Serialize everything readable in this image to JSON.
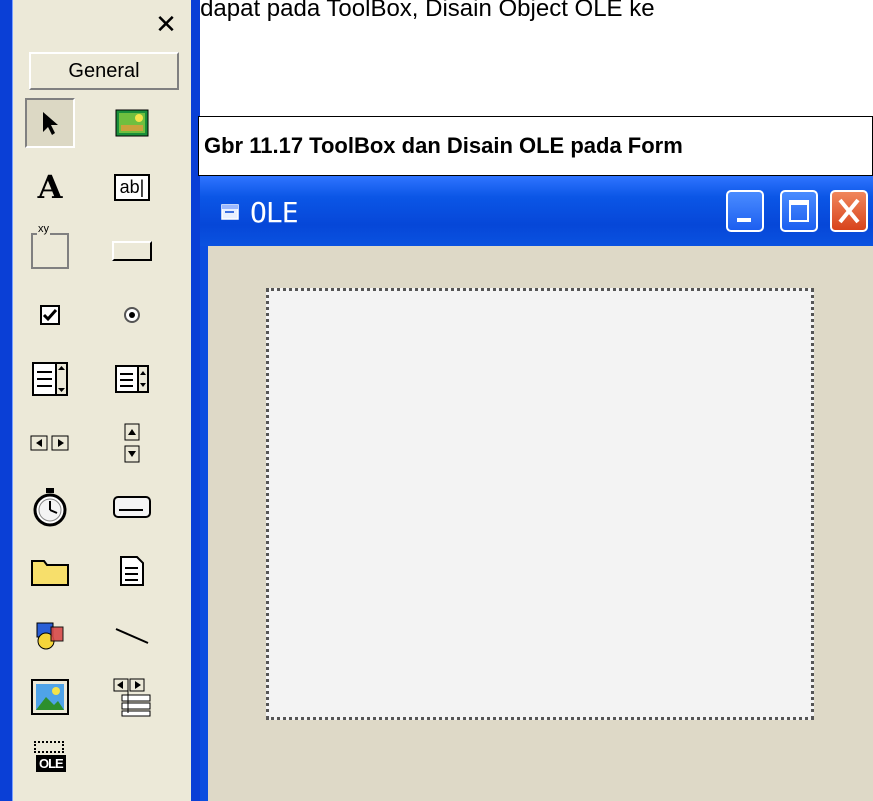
{
  "page_caption": "Click OLE yang terdapat pada ToolBox, Disain Object OLE ke",
  "toolbox": {
    "close_glyph": "✕",
    "general_label": "General",
    "tools": [
      {
        "name": "pointer-tool",
        "icon": "pointer-icon"
      },
      {
        "name": "picturebox-tool",
        "icon": "picturebox-icon"
      },
      {
        "name": "label-tool",
        "icon": "label-icon",
        "glyph": "A"
      },
      {
        "name": "textbox-tool",
        "icon": "textbox-icon",
        "glyph": "ab|"
      },
      {
        "name": "frame-tool",
        "icon": "frame-icon",
        "glyph": "xy"
      },
      {
        "name": "commandbutton-tool",
        "icon": "commandbutton-icon"
      },
      {
        "name": "checkbox-tool",
        "icon": "checkbox-icon"
      },
      {
        "name": "optionbutton-tool",
        "icon": "optionbutton-icon"
      },
      {
        "name": "combobox-tool",
        "icon": "combobox-icon"
      },
      {
        "name": "listbox-tool",
        "icon": "listbox-icon"
      },
      {
        "name": "hscrollbar-tool",
        "icon": "hscrollbar-icon"
      },
      {
        "name": "vscrollbar-tool",
        "icon": "vscrollbar-icon"
      },
      {
        "name": "timer-tool",
        "icon": "timer-icon"
      },
      {
        "name": "drivelistbox-tool",
        "icon": "drivelistbox-icon"
      },
      {
        "name": "dirlistbox-tool",
        "icon": "dirlistbox-icon"
      },
      {
        "name": "filelistbox-tool",
        "icon": "filelistbox-icon"
      },
      {
        "name": "shape-tool",
        "icon": "shape-icon"
      },
      {
        "name": "line-tool",
        "icon": "line-icon"
      },
      {
        "name": "image-tool",
        "icon": "image-icon"
      },
      {
        "name": "data-tool",
        "icon": "data-icon"
      },
      {
        "name": "ole-tool",
        "icon": "ole-icon",
        "glyph": "OLE"
      }
    ]
  },
  "figure_caption": "Gbr 11.17  ToolBox dan Disain OLE pada Form",
  "form": {
    "title": "OLE",
    "colors": {
      "titlebar": "#0a4ee0",
      "client": "#ded9c7",
      "close": "#d8431c"
    }
  }
}
